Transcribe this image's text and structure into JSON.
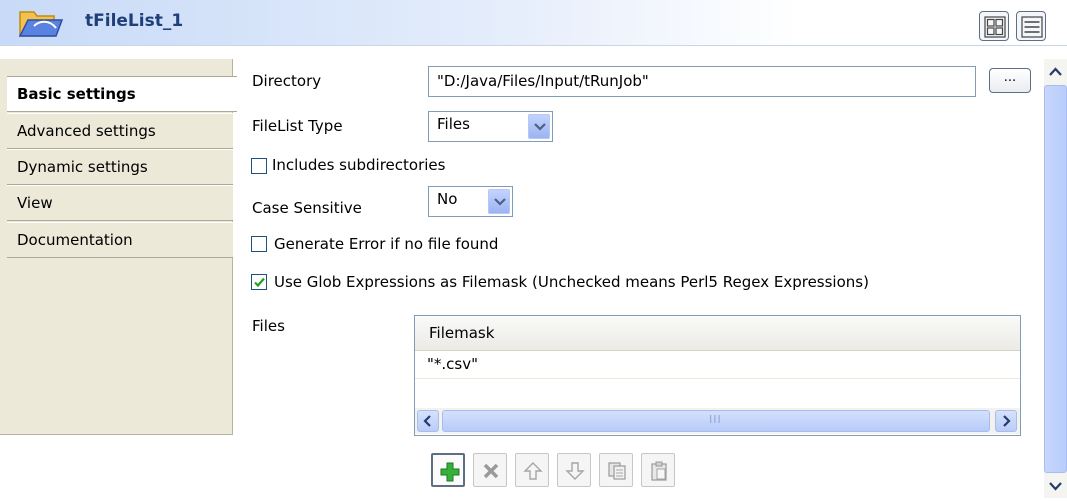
{
  "header": {
    "title": "tFileList_1",
    "icon": "file-list-component-icon",
    "view_buttons": [
      "grid-view-icon",
      "list-view-icon"
    ]
  },
  "tabs": [
    {
      "label": "Basic settings",
      "active": true
    },
    {
      "label": "Advanced settings",
      "active": false
    },
    {
      "label": "Dynamic settings",
      "active": false
    },
    {
      "label": "View",
      "active": false
    },
    {
      "label": "Documentation",
      "active": false
    }
  ],
  "form": {
    "directory": {
      "label": "Directory",
      "value": "\"D:/Java/Files/Input/tRunJob\"",
      "browse_label": "..."
    },
    "filelist_type": {
      "label": "FileList Type",
      "value": "Files"
    },
    "includes_subdirectories": {
      "label": "Includes subdirectories",
      "checked": false
    },
    "case_sensitive": {
      "label": "Case Sensitive",
      "value": "No"
    },
    "generate_error": {
      "label": "Generate Error if no file found",
      "checked": false
    },
    "use_glob": {
      "label": "Use Glob Expressions as Filemask (Unchecked means Perl5 Regex Expressions)",
      "checked": true
    },
    "files": {
      "label": "Files",
      "columns": [
        "Filemask"
      ],
      "rows": [
        [
          "\"*.csv\""
        ]
      ],
      "scroll_grip": "III"
    }
  },
  "toolbar": {
    "buttons": [
      {
        "icon": "add-icon",
        "enabled": true
      },
      {
        "icon": "delete-icon",
        "enabled": false
      },
      {
        "icon": "move-up-icon",
        "enabled": false
      },
      {
        "icon": "move-down-icon",
        "enabled": false
      },
      {
        "icon": "copy-icon",
        "enabled": false
      },
      {
        "icon": "paste-icon",
        "enabled": false
      }
    ]
  },
  "colors": {
    "accent": "#1f3f7a",
    "check": "#21a121",
    "add": "#2da52d"
  }
}
